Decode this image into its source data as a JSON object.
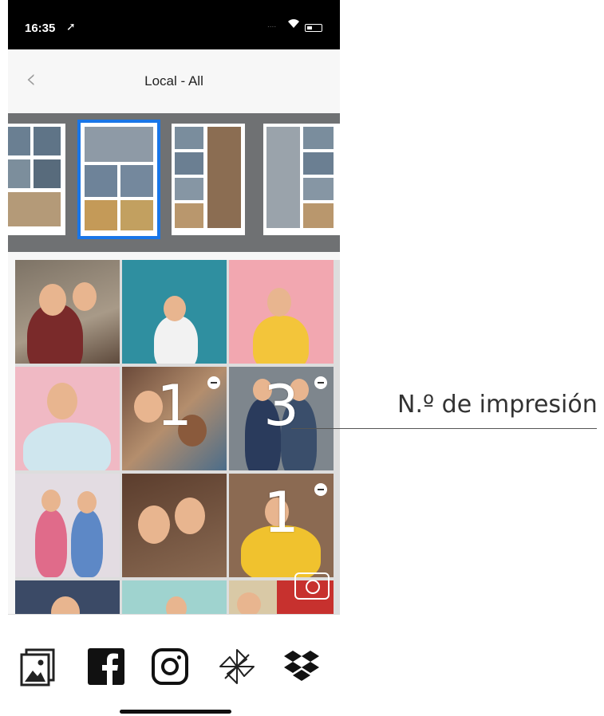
{
  "status_bar": {
    "time": "16:35",
    "location_arrow": "➚"
  },
  "nav": {
    "back_icon": "chevron-left-icon",
    "title": "Local - All"
  },
  "photo_counts": {
    "p5": "1",
    "p6": "3",
    "p9": "1"
  },
  "sources": [
    {
      "name": "gallery-icon"
    },
    {
      "name": "facebook-icon"
    },
    {
      "name": "instagram-icon"
    },
    {
      "name": "pinwheel-icon"
    },
    {
      "name": "dropbox-icon"
    }
  ],
  "annotation": {
    "label": "N.º de impresión"
  },
  "colors": {
    "selected_border": "#1976e8",
    "template_bg": "#6f7173"
  }
}
